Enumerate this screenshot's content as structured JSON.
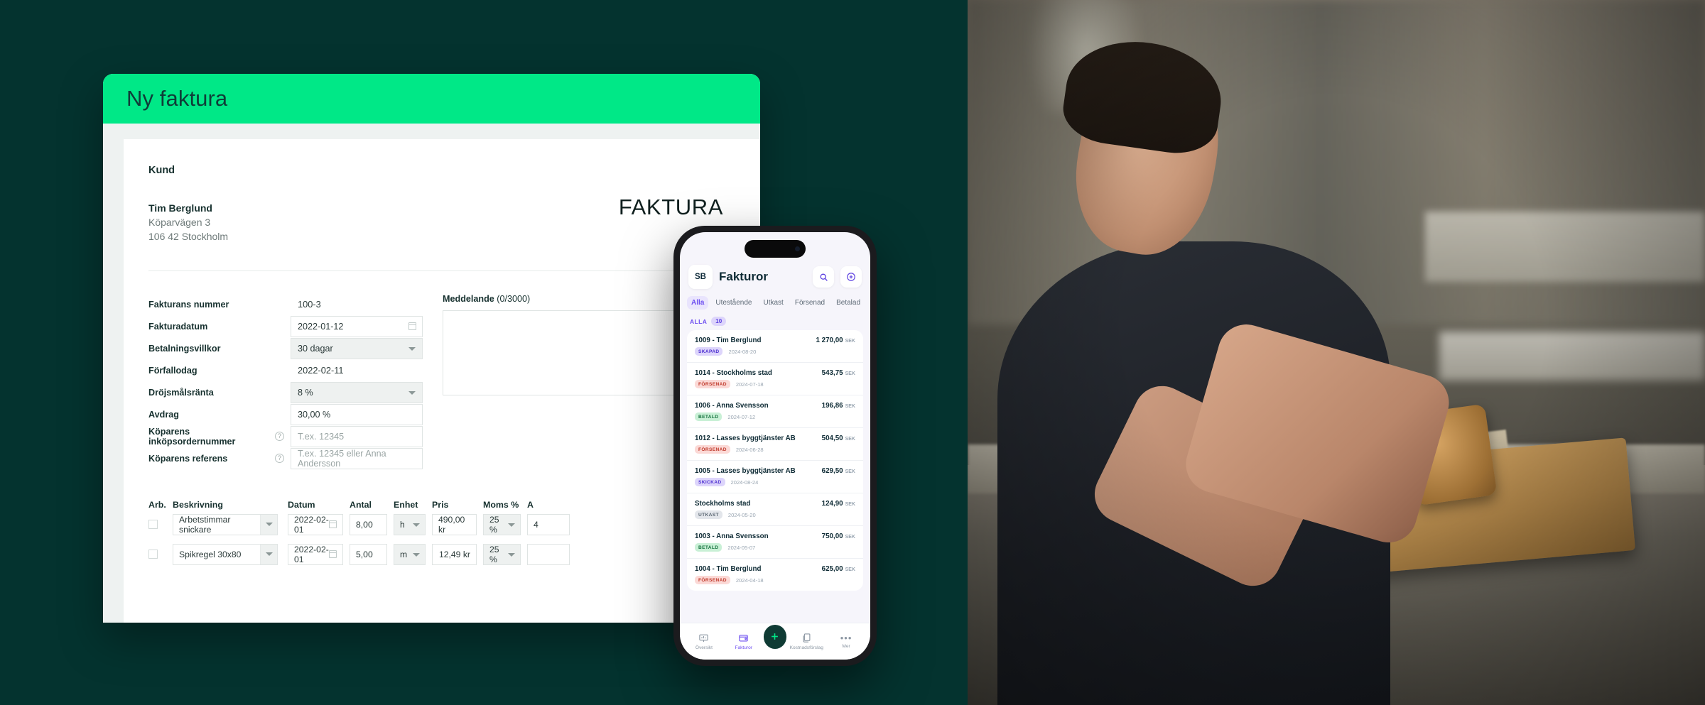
{
  "theme": {
    "bg_teal": "#04332f",
    "accent_green": "#00e887",
    "dark_green": "#0f3b34",
    "purple": "#6c4df0"
  },
  "desktop": {
    "window_title": "Ny faktura",
    "customer": {
      "heading": "Kund",
      "name": "Tim Berglund",
      "street": "Köparvägen 3",
      "city": "106 42 Stockholm"
    },
    "document_word": "FAKTURA",
    "fields": [
      {
        "label": "Fakturans nummer",
        "value": "100-3",
        "type": "plain",
        "help": false
      },
      {
        "label": "Fakturadatum",
        "value": "2022-01-12",
        "type": "date",
        "help": false
      },
      {
        "label": "Betalningsvillkor",
        "value": "30 dagar",
        "type": "select",
        "help": false
      },
      {
        "label": "Förfallodag",
        "value": "2022-02-11",
        "type": "plain",
        "help": false
      },
      {
        "label": "Dröjsmålsränta",
        "value": "8 %",
        "type": "select",
        "help": false
      },
      {
        "label": "Avdrag",
        "value": "30,00 %",
        "type": "input",
        "help": false
      },
      {
        "label": "Köparens inköpsordernummer",
        "value": "",
        "placeholder": "T.ex. 12345",
        "type": "input",
        "help": true
      },
      {
        "label": "Köparens referens",
        "value": "",
        "placeholder": "T.ex. 12345 eller Anna Andersson",
        "type": "input",
        "help": true
      }
    ],
    "message": {
      "label": "Meddelande",
      "counter": "(0/3000)",
      "value": ""
    },
    "table": {
      "headers": {
        "arb": "Arb.",
        "beskrivning": "Beskrivning",
        "datum": "Datum",
        "antal": "Antal",
        "enhet": "Enhet",
        "pris": "Pris",
        "moms": "Moms %",
        "sum": "A"
      },
      "rows": [
        {
          "checked": false,
          "beskrivning": "Arbetstimmar snickare",
          "datum": "2022-02-01",
          "antal": "8,00",
          "enhet": "h",
          "pris": "490,00 kr",
          "moms": "25 %",
          "sum": "4"
        },
        {
          "checked": false,
          "beskrivning": "Spikregel 30x80",
          "datum": "2022-02-01",
          "antal": "5,00",
          "enhet": "m",
          "pris": "12,49 kr",
          "moms": "25 %",
          "sum": ""
        }
      ]
    }
  },
  "phone": {
    "avatar_initials": "SB",
    "title": "Fakturor",
    "tabs": [
      {
        "label": "Alla",
        "active": true
      },
      {
        "label": "Utestående",
        "active": false
      },
      {
        "label": "Utkast",
        "active": false
      },
      {
        "label": "Försenad",
        "active": false
      },
      {
        "label": "Betalad",
        "active": false
      }
    ],
    "list_header": {
      "label": "ALLA",
      "count": "10"
    },
    "currency": "SEK",
    "invoices": [
      {
        "name": "1009 - Tim Berglund",
        "amount": "1 270,00",
        "status": "SKAPAD",
        "status_class": "b-skapad",
        "date": "2024-08-20"
      },
      {
        "name": "1014 - Stockholms stad",
        "amount": "543,75",
        "status": "FÖRSENAD",
        "status_class": "b-forsenad",
        "date": "2024-07-18"
      },
      {
        "name": "1006 - Anna Svensson",
        "amount": "196,86",
        "status": "BETALD",
        "status_class": "b-betald",
        "date": "2024-07-12"
      },
      {
        "name": "1012 - Lasses byggtjänster AB",
        "amount": "504,50",
        "status": "FÖRSENAD",
        "status_class": "b-forsenad",
        "date": "2024-06-28"
      },
      {
        "name": "1005 - Lasses byggtjänster AB",
        "amount": "629,50",
        "status": "SKICKAD",
        "status_class": "b-skickad",
        "date": "2024-08-24"
      },
      {
        "name": "Stockholms stad",
        "amount": "124,90",
        "status": "UTKAST",
        "status_class": "b-utkast",
        "date": "2024-05-20"
      },
      {
        "name": "1003 - Anna Svensson",
        "amount": "750,00",
        "status": "BETALD",
        "status_class": "b-betald",
        "date": "2024-05-07"
      },
      {
        "name": "1004 - Tim Berglund",
        "amount": "625,00",
        "status": "FÖRSENAD",
        "status_class": "b-forsenad",
        "date": "2024-04-18"
      }
    ],
    "tabbar": [
      {
        "label": "Översikt",
        "active": false
      },
      {
        "label": "Fakturor",
        "active": true
      },
      {
        "label": "Kostnadsförslag",
        "active": false
      },
      {
        "label": "Mer",
        "active": false
      }
    ]
  }
}
